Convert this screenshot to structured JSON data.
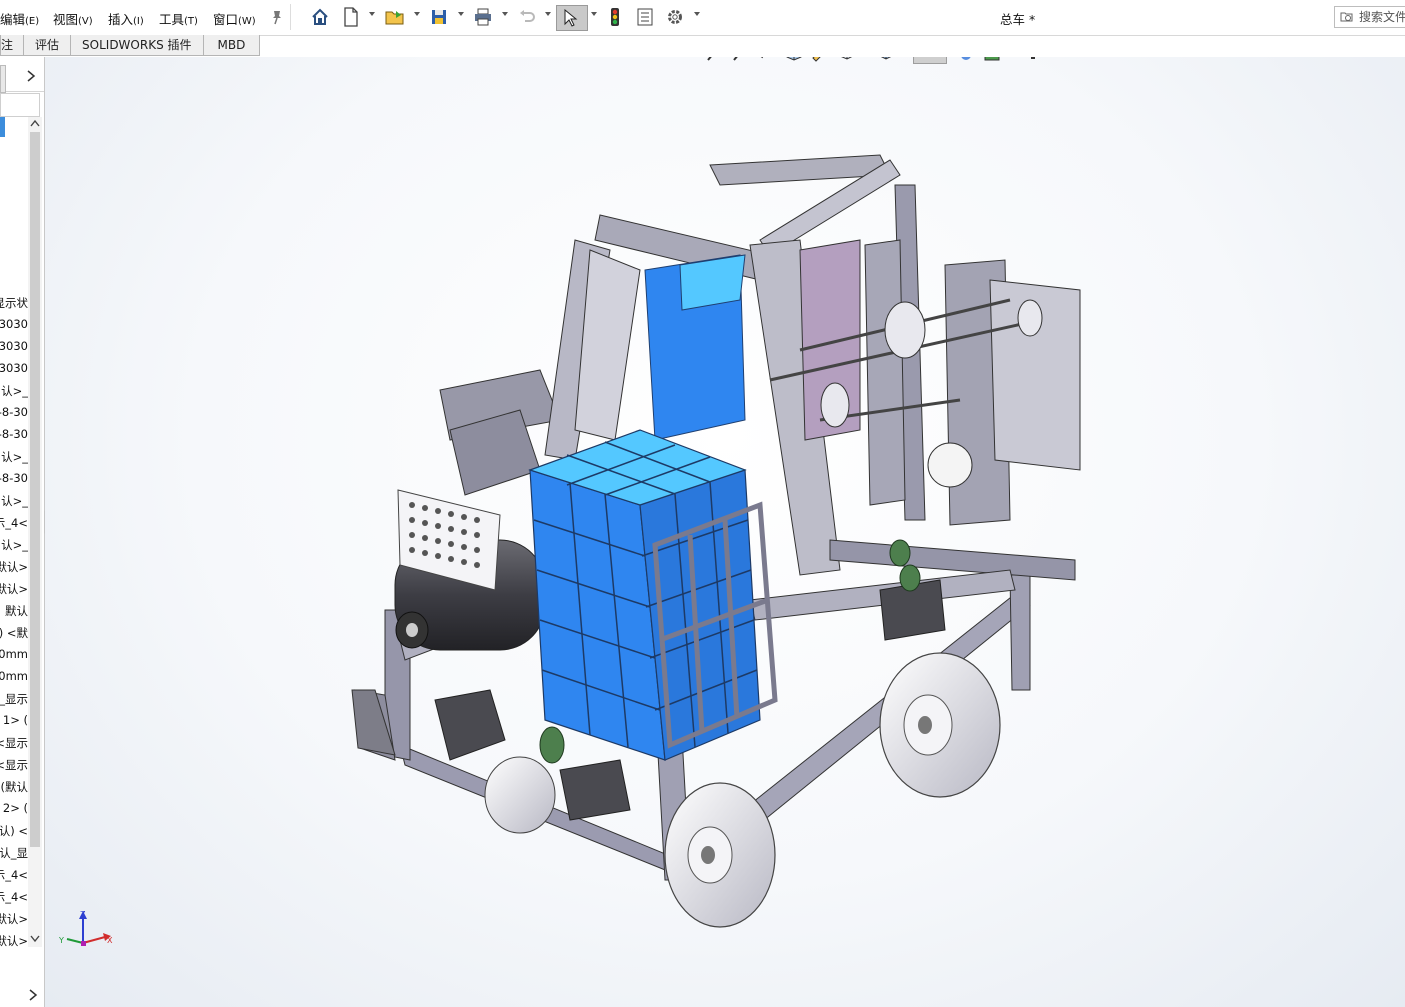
{
  "menu": {
    "items": [
      {
        "label": "编辑",
        "key": "(E)"
      },
      {
        "label": "视图",
        "key": "(V)"
      },
      {
        "label": "插入",
        "key": "(I)"
      },
      {
        "label": "工具",
        "key": "(T)"
      },
      {
        "label": "窗口",
        "key": "(W)"
      }
    ]
  },
  "title": "总车 *",
  "search": {
    "placeholder": "搜索文件"
  },
  "tabs": [
    "注",
    "评估",
    "SOLIDWORKS 插件",
    "MBD"
  ],
  "tree": {
    "items": [
      "显示状",
      "3030",
      "3030",
      "3030",
      "认>_",
      "-8-30",
      "-8-30",
      "认>_",
      "-8-30",
      "认>_",
      "示_4<",
      "认>_",
      "默认>",
      "默认>",
      "默认",
      "认) <默",
      "00mm",
      "00mm",
      ">_显示",
      "1> (",
      "<显示",
      "<显示",
      "(默认",
      "2> (",
      "认) <",
      "认_显",
      "示_4<",
      "示_4<",
      "默认>",
      "默认>"
    ]
  },
  "colors": {
    "accent": "#3c8ddc",
    "model_blue": "#2f86f0",
    "model_blue_light": "#54c8ff",
    "frame": "#8c8c99"
  }
}
